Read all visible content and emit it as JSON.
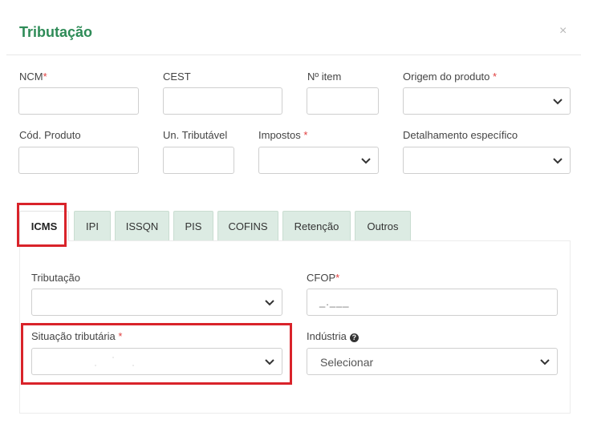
{
  "modal": {
    "title": "Tributação",
    "close": "×"
  },
  "fields": {
    "ncm": {
      "label": "NCM",
      "required": "*",
      "value": ""
    },
    "cest": {
      "label": "CEST",
      "value": ""
    },
    "item_number": {
      "label": "Nº item",
      "value": ""
    },
    "origem": {
      "label": "Origem do produto",
      "required": "*",
      "value": ""
    },
    "cod_produto": {
      "label": "Cód. Produto",
      "value": ""
    },
    "un_tributavel": {
      "label": "Un. Tributável",
      "value": ""
    },
    "impostos": {
      "label": "Impostos",
      "required": "*",
      "value": ""
    },
    "detalhamento": {
      "label": "Detalhamento específico",
      "value": ""
    }
  },
  "tabs": [
    {
      "label": "ICMS",
      "active": true
    },
    {
      "label": "IPI"
    },
    {
      "label": "ISSQN"
    },
    {
      "label": "PIS"
    },
    {
      "label": "COFINS"
    },
    {
      "label": "Retenção"
    },
    {
      "label": "Outros"
    }
  ],
  "icms": {
    "tributacao": {
      "label": "Tributação",
      "value": ""
    },
    "cfop": {
      "label": "CFOP",
      "required": "*",
      "placeholder": "_.___"
    },
    "situacao": {
      "label": "Situação tributária",
      "required": "*",
      "value": ""
    },
    "industria": {
      "label": "Indústria",
      "value": "Selecionar",
      "help": "?"
    }
  },
  "colors": {
    "title": "#2e8b57",
    "tab_inactive": "#dcebe3",
    "highlight": "#d9232a",
    "required": "#e04040"
  }
}
